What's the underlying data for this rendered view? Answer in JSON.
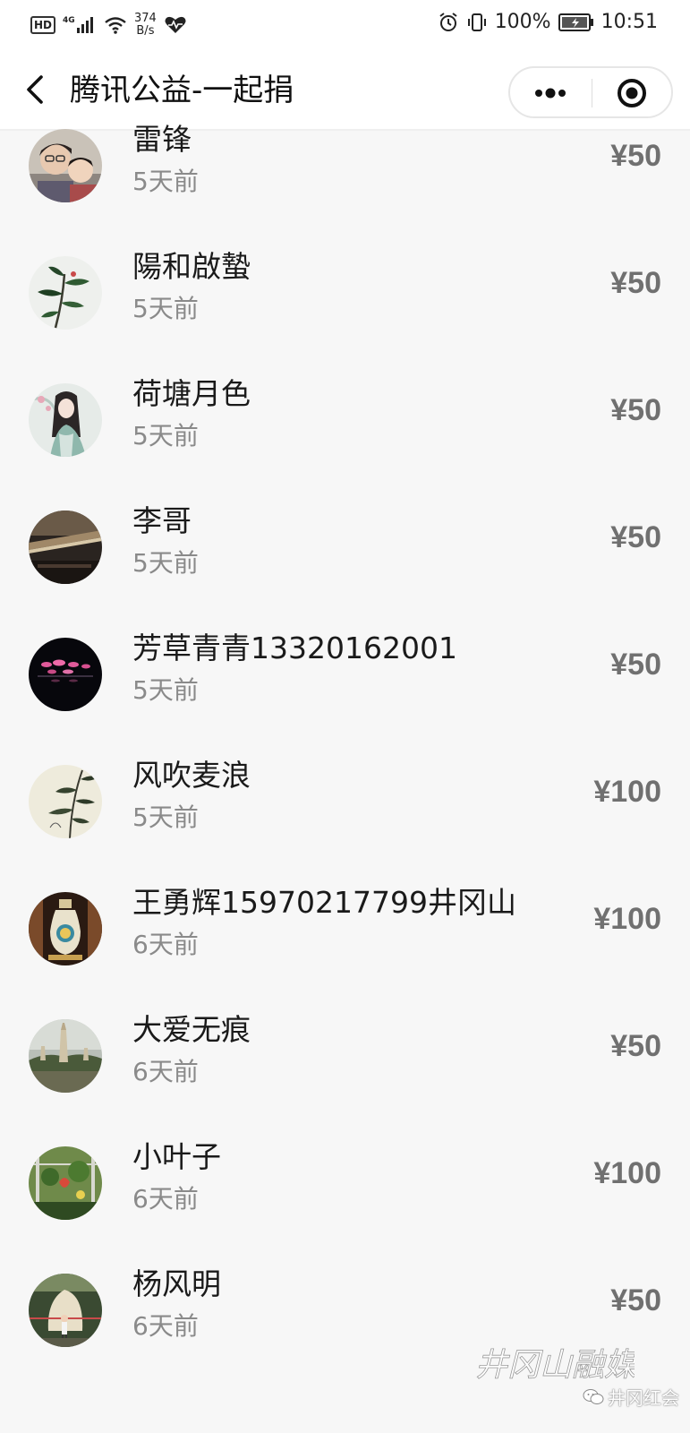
{
  "status_bar": {
    "hd": "HD",
    "network": "4G",
    "speed_value": "374",
    "speed_unit": "B/s",
    "battery": "100%",
    "time": "10:51"
  },
  "nav": {
    "title": "腾讯公益-一起捐"
  },
  "donors": [
    {
      "name": "雷锋",
      "time": "5天前",
      "amount": "¥50",
      "avatar": "two-people"
    },
    {
      "name": "陽和啟蟄",
      "time": "5天前",
      "amount": "¥50",
      "avatar": "plant"
    },
    {
      "name": "荷塘月色",
      "time": "5天前",
      "amount": "¥50",
      "avatar": "painted-lady"
    },
    {
      "name": "李哥",
      "time": "5天前",
      "amount": "¥50",
      "avatar": "dark-object"
    },
    {
      "name": "芳草青青13320162001",
      "time": "5天前",
      "amount": "¥50",
      "avatar": "lotus-lights"
    },
    {
      "name": "风吹麦浪",
      "time": "5天前",
      "amount": "¥100",
      "avatar": "bamboo"
    },
    {
      "name": "王勇辉15970217799井冈山",
      "time": "6天前",
      "amount": "¥100",
      "avatar": "vase"
    },
    {
      "name": "大爱无痕",
      "time": "6天前",
      "amount": "¥50",
      "avatar": "pagoda"
    },
    {
      "name": "小叶子",
      "time": "6天前",
      "amount": "¥100",
      "avatar": "garden"
    },
    {
      "name": "杨风明",
      "time": "6天前",
      "amount": "¥50",
      "avatar": "person-rock"
    }
  ],
  "watermark": {
    "calligraphy": "井冈山融媒",
    "badge": "井冈红会"
  }
}
